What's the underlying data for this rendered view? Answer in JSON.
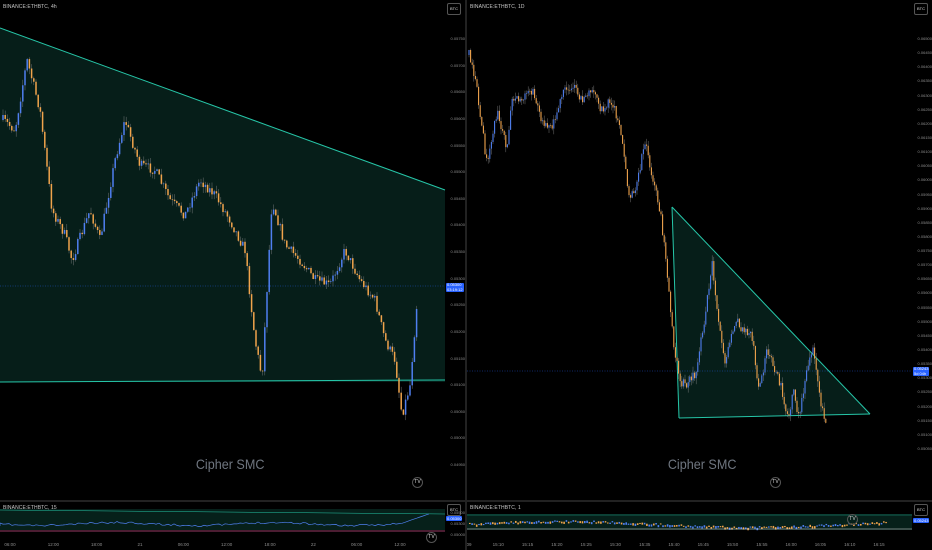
{
  "left_chart": {
    "symbol": "BINANCE:ETHBTC, 4h",
    "currency_badge": "BTC",
    "current_price": "0.05300",
    "price_subtext": "03:19:12",
    "watermark": "Cipher SMC",
    "y_labels": [
      "0.05750",
      "0.05700",
      "0.05650",
      "0.05600",
      "0.05550",
      "0.05500",
      "0.05450",
      "0.05400",
      "0.05350",
      "0.05300",
      "0.05250",
      "0.05200",
      "0.05150",
      "0.05100",
      "0.05050",
      "0.05000",
      "0.04950"
    ],
    "x_labels": [
      "13",
      "16",
      "20",
      "23",
      "27",
      "Dec",
      "4",
      "7",
      "11",
      "14",
      "18",
      "21",
      "25"
    ]
  },
  "right_chart": {
    "symbol": "BINANCE:ETHBTC, 1D",
    "currency_badge": "BTC",
    "current_price": "0.05243",
    "price_subtext": "5d 04h",
    "watermark": "Cipher SMC",
    "y_labels": [
      "0.06500",
      "0.06450",
      "0.06400",
      "0.06350",
      "0.06300",
      "0.06250",
      "0.06200",
      "0.06150",
      "0.06100",
      "0.06050",
      "0.06000",
      "0.05950",
      "0.05900",
      "0.05850",
      "0.05800",
      "0.05750",
      "0.05700",
      "0.05650",
      "0.05600",
      "0.05550",
      "0.05500",
      "0.05450",
      "0.05400",
      "0.05350",
      "0.05300",
      "0.05250",
      "0.05200",
      "0.05150",
      "0.05100",
      "0.05050"
    ],
    "x_labels": [
      "Jul",
      "17",
      "Aug",
      "15",
      "Sep",
      "15",
      "Oct",
      "16",
      "Nov",
      "15",
      "Dec",
      "18",
      "2024",
      "15",
      "Feb",
      "15",
      "Mar"
    ]
  },
  "bottom_left": {
    "symbol": "BINANCE:ETHBTC, 15",
    "currency_badge": "BTC",
    "price_tag": "0.05300",
    "y_labels": [
      "0.05500",
      "0.05300",
      "0.05000"
    ],
    "x_labels": [
      "06:00",
      "12:00",
      "18:00",
      "21",
      "06:00",
      "12:00",
      "18:00",
      "22",
      "06:00",
      "12:00"
    ]
  },
  "bottom_right": {
    "symbol": "BINANCE:ETHBTC, 1",
    "currency_badge": "BTC",
    "price_tag": "0.05243",
    "x_labels": [
      "09",
      "15:10",
      "15:15",
      "15:20",
      "15:25",
      "15:30",
      "15:35",
      "15:40",
      "15:45",
      "15:50",
      "15:55",
      "16:00",
      "16:05",
      "16:10",
      "16:15"
    ]
  },
  "logo_text": "TV",
  "colors": {
    "up": "#4f7ff0",
    "down": "#f0a44c",
    "wick": "#8a8a8a",
    "triangle": "#26c6a8",
    "zone_fill": "#06201a",
    "price_line": "#2962ff"
  }
}
